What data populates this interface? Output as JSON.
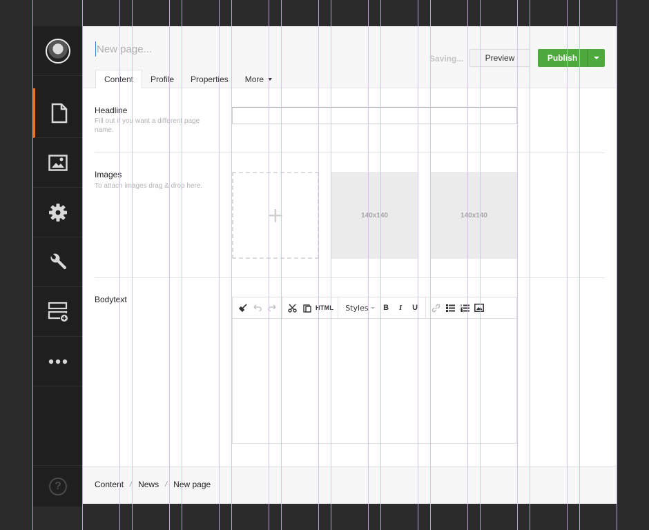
{
  "sidebar": {
    "items": [
      {
        "icon": "avatar"
      },
      {
        "icon": "document-icon"
      },
      {
        "icon": "image-icon"
      },
      {
        "icon": "gear-icon"
      },
      {
        "icon": "wrench-icon"
      },
      {
        "icon": "add-block-icon"
      },
      {
        "icon": "more-icon"
      }
    ],
    "help_icon": "?"
  },
  "header": {
    "title_placeholder": "New page...",
    "saving_status": "Saving...",
    "preview_label": "Preview",
    "publish_label": "Publish"
  },
  "tabs": [
    {
      "label": "Content"
    },
    {
      "label": "Profile"
    },
    {
      "label": "Properties"
    },
    {
      "label": "More"
    }
  ],
  "fields": {
    "headline": {
      "label": "Headline",
      "help": "Fill out if you want a different page name."
    },
    "images": {
      "label": "Images",
      "help": "To attach images drag & drop here.",
      "drop_symbol": "+",
      "thumbs": [
        "140x140",
        "140x140"
      ]
    },
    "bodytext": {
      "label": "Bodytext",
      "toolbar": {
        "html_label": "HTML",
        "styles_label": "Styles",
        "bold_label": "B",
        "italic_label": "I",
        "underline_label": "U"
      }
    }
  },
  "breadcrumb": {
    "items": [
      "Content",
      "News",
      "New page"
    ],
    "separator": "/"
  },
  "colors": {
    "accent": "#e0772a",
    "publish": "#4faa3e",
    "guides": "#7fe3ef"
  }
}
